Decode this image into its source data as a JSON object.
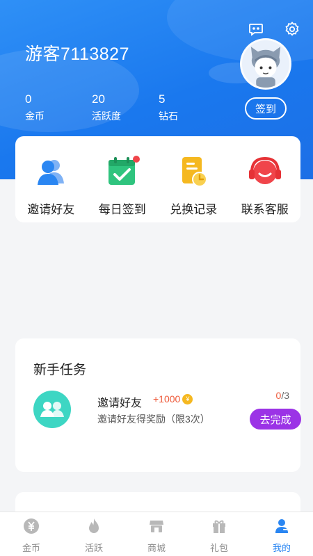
{
  "header": {
    "username": "游客7113827",
    "stats": [
      {
        "value": "0",
        "label": "金币"
      },
      {
        "value": "20",
        "label": "活跃度"
      },
      {
        "value": "5",
        "label": "钻石"
      }
    ],
    "signin_label": "签到",
    "icons": [
      "message-icon",
      "settings-icon"
    ]
  },
  "quick_actions": [
    {
      "label": "邀请好友",
      "icon": "users-icon"
    },
    {
      "label": "每日签到",
      "icon": "calendar-check-icon",
      "badge": true
    },
    {
      "label": "兑换记录",
      "icon": "record-icon"
    },
    {
      "label": "联系客服",
      "icon": "headset-icon"
    }
  ],
  "novice_tasks": {
    "title": "新手任务",
    "items": [
      {
        "name": "邀请好友",
        "reward": "+1000",
        "description": "邀请好友得奖励（限3次）",
        "progress_current": "0",
        "progress_total": "/3",
        "action_label": "去完成"
      }
    ]
  },
  "tabbar": {
    "items": [
      {
        "label": "金币",
        "icon": "coin-icon"
      },
      {
        "label": "活跃",
        "icon": "flame-icon"
      },
      {
        "label": "商城",
        "icon": "shop-icon"
      },
      {
        "label": "礼包",
        "icon": "gift-icon"
      },
      {
        "label": "我的",
        "icon": "profile-icon",
        "active": true
      }
    ]
  },
  "colors": {
    "header_blue": "#1a78ee",
    "accent_purple": "#9b33e6",
    "reward_red": "#ee5a3a",
    "tab_active": "#2a86f2",
    "task_icon_teal": "#3dd6c3"
  }
}
